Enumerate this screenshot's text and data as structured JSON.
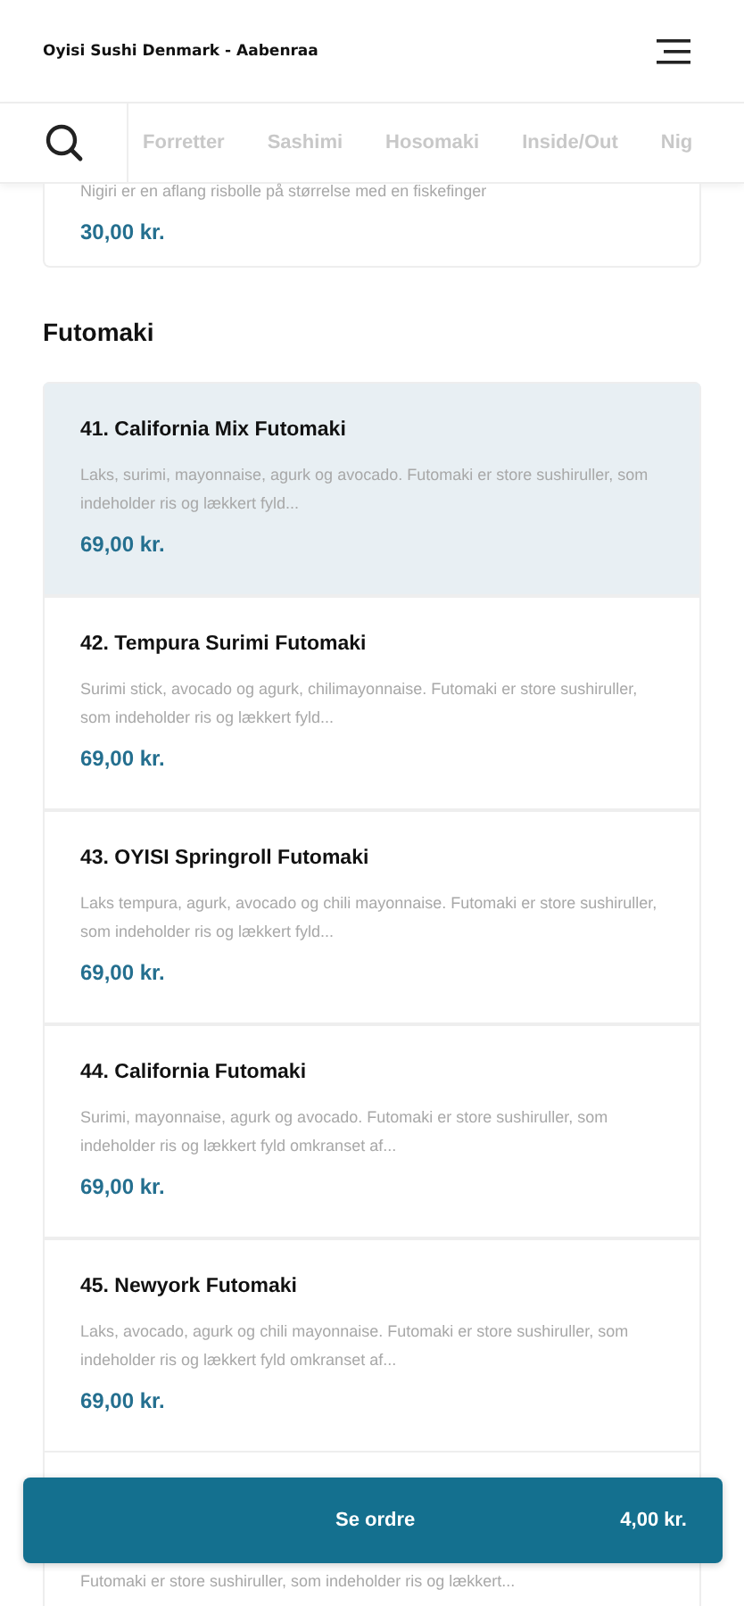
{
  "header": {
    "title": "Oyisi Sushi Denmark - Aabenraa"
  },
  "category_tabs": [
    {
      "label": "Forretter",
      "selected": false
    },
    {
      "label": "Sashimi",
      "selected": false
    },
    {
      "label": "Hosomaki",
      "selected": false
    },
    {
      "label": "Inside/Out",
      "selected": false
    },
    {
      "label": "Nig",
      "selected": false
    }
  ],
  "previous_item": {
    "description": "Nigiri er en aflang risbolle på størrelse med en fiskefinger",
    "price": "30,00 kr."
  },
  "section": {
    "title": "Futomaki",
    "items": [
      {
        "name": "41. California Mix Futomaki",
        "description": "Laks, surimi, mayonnaise, agurk og avocado. Futomaki er store sushiruller, som indeholder ris og lækkert fyld...",
        "price": "69,00 kr.",
        "highlighted": true
      },
      {
        "name": "42. Tempura Surimi Futomaki",
        "description": "Surimi stick, avocado og agurk, chilimayonnaise. Futomaki er store sushiruller, som indeholder ris og lækkert fyld...",
        "price": "69,00 kr.",
        "highlighted": false
      },
      {
        "name": "43. OYISI Springroll Futomaki",
        "description": "Laks tempura, agurk, avocado og chili mayonnaise. Futomaki er store sushiruller, som indeholder ris og lækkert fyld...",
        "price": "69,00 kr.",
        "highlighted": false
      },
      {
        "name": "44. California Futomaki",
        "description": "Surimi, mayonnaise, agurk og avocado. Futomaki er store sushiruller, som indeholder ris og lækkert fyld omkranset af...",
        "price": "69,00 kr.",
        "highlighted": false
      },
      {
        "name": "45. Newyork Futomaki",
        "description": "Laks, avocado, agurk og chili mayonnaise. Futomaki er store sushiruller, som indeholder ris og lækkert fyld omkranset af...",
        "price": "69,00 kr.",
        "highlighted": false
      }
    ],
    "next_item_partial": {
      "description": "Futomaki er store sushiruller, som indeholder ris og lækkert..."
    }
  },
  "order_button": {
    "label": "Se ordre",
    "total": "4,00 kr."
  }
}
